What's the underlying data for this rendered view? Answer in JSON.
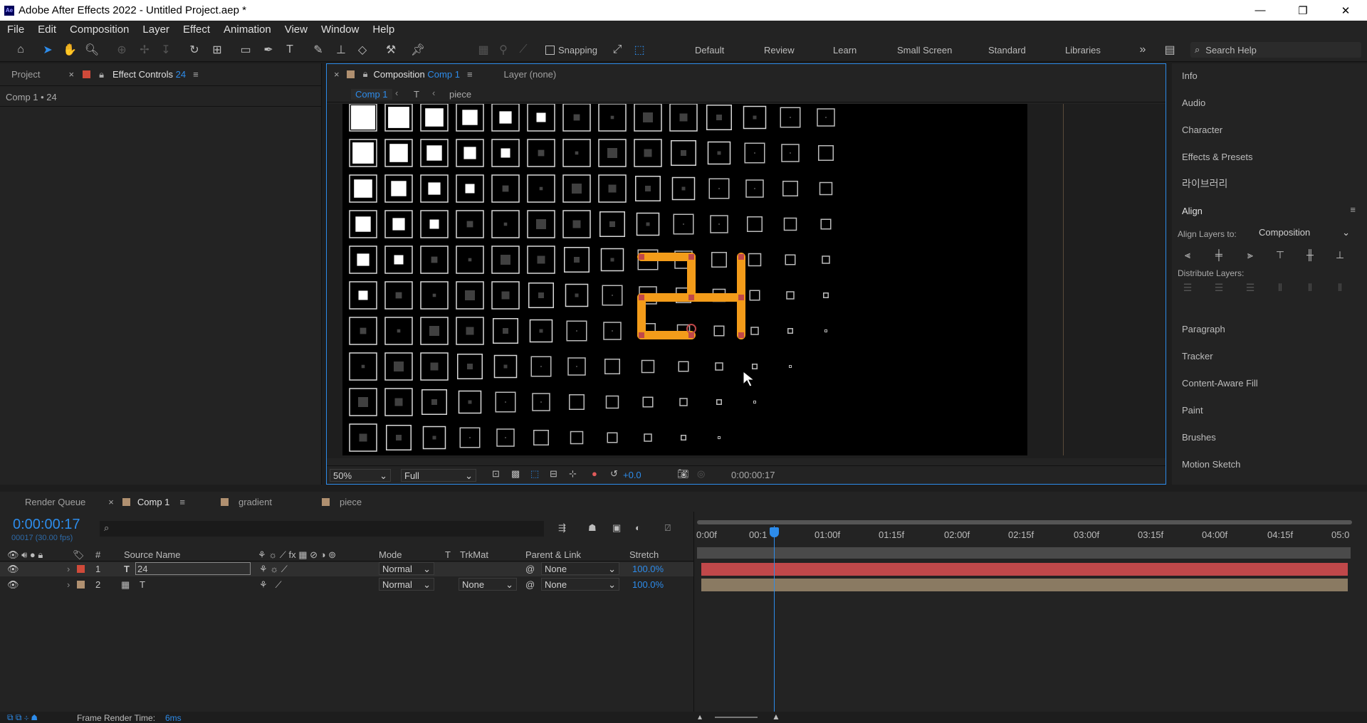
{
  "window": {
    "title": "Adobe After Effects 2022 - Untitled Project.aep *",
    "logo": "Ae",
    "minimize": "—",
    "restore": "❐",
    "close": "✕"
  },
  "menu": [
    "File",
    "Edit",
    "Composition",
    "Layer",
    "Effect",
    "Animation",
    "View",
    "Window",
    "Help"
  ],
  "toolbar": {
    "snapping": "Snapping",
    "workspaces": [
      "Default",
      "Review",
      "Learn",
      "Small Screen",
      "Standard",
      "Libraries"
    ],
    "search_placeholder": "Search Help"
  },
  "left_panel": {
    "tab_project": "Project",
    "tab_effect_controls": "Effect Controls",
    "effect_controls_num": "24",
    "subtitle": "Comp 1 • 24"
  },
  "comp_panel": {
    "tab_label": "Composition",
    "comp_name": "Comp 1",
    "layer_tab": "Layer (none)",
    "breadcrumbs": [
      "Comp 1",
      "T",
      "piece"
    ],
    "zoom": "50%",
    "resolution": "Full",
    "exposure": "+0.0",
    "timecode": "0:00:00:17",
    "canvas_text": "24"
  },
  "right_panel": {
    "items_top": [
      "Info",
      "Audio",
      "Character",
      "Effects & Presets",
      "라이브러리"
    ],
    "align_title": "Align",
    "align_layers_to_label": "Align Layers to:",
    "align_layers_to_value": "Composition",
    "distribute_label": "Distribute Layers:",
    "items_bottom": [
      "Paragraph",
      "Tracker",
      "Content-Aware Fill",
      "Paint",
      "Brushes",
      "Motion Sketch"
    ]
  },
  "timeline": {
    "tabs": [
      "Render Queue",
      "Comp 1",
      "gradient",
      "piece"
    ],
    "timecode": "0:00:00:17",
    "frame_info": "00017 (30.00 fps)",
    "columns": {
      "source": "Source Name",
      "mode": "Mode",
      "t": "T",
      "trkmat": "TrkMat",
      "parent": "Parent & Link",
      "stretch": "Stretch",
      "num": "#"
    },
    "layers": [
      {
        "num": "1",
        "type": "T",
        "name": "24",
        "mode": "Normal",
        "trkmat": "",
        "parent": "None",
        "stretch": "100.0%",
        "color": "#d04a3a"
      },
      {
        "num": "2",
        "type": "T",
        "name": "T",
        "mode": "Normal",
        "trkmat": "None",
        "parent": "None",
        "stretch": "100.0%",
        "color": "#b09070"
      }
    ],
    "ruler_ticks": [
      "0:00f",
      "00:1",
      "01:00f",
      "01:15f",
      "02:00f",
      "02:15f",
      "03:00f",
      "03:15f",
      "04:00f",
      "04:15f",
      "05:0"
    ],
    "playhead_percent": 11.3
  },
  "status": {
    "render_label": "Frame Render Time:",
    "render_value": "6ms"
  },
  "colors": {
    "accent": "#2d8ceb",
    "layer1_bar": "#c0484a",
    "layer2_bar": "#8a7a62",
    "text_orange": "#f39c1a"
  }
}
